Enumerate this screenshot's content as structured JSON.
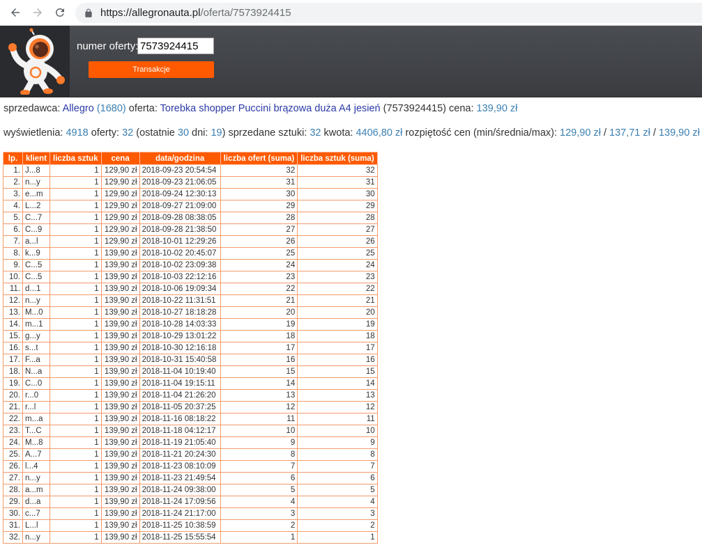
{
  "browser": {
    "url_host": "https://allegronauta.pl",
    "url_path": "/oferta/7573924415"
  },
  "header": {
    "offer_label": "numer oferty:",
    "offer_value": "7573924415",
    "button_label": "Transakcje"
  },
  "info": {
    "seller_label": "sprzedawca:",
    "seller_name": "Allegro",
    "seller_score": "(1680)",
    "offer_label": "oferta:",
    "offer_title": "Torebka shopper Puccini brązowa duża A4 jesień",
    "offer_id": "(7573924415)",
    "price_label": "cena:",
    "price": "139,90 zł",
    "views_label": "wyświetlenia:",
    "views": "4918",
    "offers_label": "oferty:",
    "offers": "32",
    "last_open": "(ostatnie",
    "last_days": "30",
    "days_label": "dni:",
    "last_count": "19",
    "last_close": ")",
    "sold_label": "sprzedane sztuki:",
    "sold": "32",
    "amount_label": "kwota:",
    "amount": "4406,80 zł",
    "range_label": "rozpiętość cen (min/średnia/max):",
    "min": "129,90 zł",
    "avg": "137,71 zł",
    "max": "139,90 zł",
    "sep": "/"
  },
  "table": {
    "headers": [
      "lp.",
      "klient",
      "liczba sztuk",
      "cena",
      "data/godzina",
      "liczba ofert (suma)",
      "liczba sztuk (suma)"
    ],
    "rows": [
      [
        "1.",
        "J...8",
        "1",
        "129,90 zł",
        "2018-09-23 20:54:54",
        "32",
        "32"
      ],
      [
        "2.",
        "n...y",
        "1",
        "129,90 zł",
        "2018-09-23 21:06:05",
        "31",
        "31"
      ],
      [
        "3.",
        "e...m",
        "1",
        "129,90 zł",
        "2018-09-24 12:30:13",
        "30",
        "30"
      ],
      [
        "4.",
        "L...2",
        "1",
        "129,90 zł",
        "2018-09-27 21:09:00",
        "29",
        "29"
      ],
      [
        "5.",
        "C...7",
        "1",
        "129,90 zł",
        "2018-09-28 08:38:05",
        "28",
        "28"
      ],
      [
        "6.",
        "C...9",
        "1",
        "129,90 zł",
        "2018-09-28 21:38:50",
        "27",
        "27"
      ],
      [
        "7.",
        "a...l",
        "1",
        "129,90 zł",
        "2018-10-01 12:29:26",
        "26",
        "26"
      ],
      [
        "8.",
        "k...9",
        "1",
        "139,90 zł",
        "2018-10-02 20:45:07",
        "25",
        "25"
      ],
      [
        "9.",
        "C...5",
        "1",
        "139,90 zł",
        "2018-10-02 23:09:38",
        "24",
        "24"
      ],
      [
        "10.",
        "C...5",
        "1",
        "139,90 zł",
        "2018-10-03 22:12:16",
        "23",
        "23"
      ],
      [
        "11.",
        "d...1",
        "1",
        "139,90 zł",
        "2018-10-06 19:09:34",
        "22",
        "22"
      ],
      [
        "12.",
        "n...y",
        "1",
        "139,90 zł",
        "2018-10-22 11:31:51",
        "21",
        "21"
      ],
      [
        "13.",
        "M...0",
        "1",
        "139,90 zł",
        "2018-10-27 18:18:28",
        "20",
        "20"
      ],
      [
        "14.",
        "m...1",
        "1",
        "139,90 zł",
        "2018-10-28 14:03:33",
        "19",
        "19"
      ],
      [
        "15.",
        "g...y",
        "1",
        "139,90 zł",
        "2018-10-29 13:01:22",
        "18",
        "18"
      ],
      [
        "16.",
        "s...t",
        "1",
        "139,90 zł",
        "2018-10-30 12:16:18",
        "17",
        "17"
      ],
      [
        "17.",
        "F...a",
        "1",
        "139,90 zł",
        "2018-10-31 15:40:58",
        "16",
        "16"
      ],
      [
        "18.",
        "N...a",
        "1",
        "139,90 zł",
        "2018-11-04 10:19:40",
        "15",
        "15"
      ],
      [
        "19.",
        "C...0",
        "1",
        "139,90 zł",
        "2018-11-04 19:15:11",
        "14",
        "14"
      ],
      [
        "20.",
        "r...0",
        "1",
        "139,90 zł",
        "2018-11-04 21:26:20",
        "13",
        "13"
      ],
      [
        "21.",
        "r...l",
        "1",
        "139,90 zł",
        "2018-11-05 20:37:25",
        "12",
        "12"
      ],
      [
        "22.",
        "m...a",
        "1",
        "139,90 zł",
        "2018-11-16 08:18:22",
        "11",
        "11"
      ],
      [
        "23.",
        "T...C",
        "1",
        "139,90 zł",
        "2018-11-18 04:12:17",
        "10",
        "10"
      ],
      [
        "24.",
        "M...8",
        "1",
        "139,90 zł",
        "2018-11-19 21:05:40",
        "9",
        "9"
      ],
      [
        "25.",
        "A...7",
        "1",
        "139,90 zł",
        "2018-11-21 20:24:30",
        "8",
        "8"
      ],
      [
        "26.",
        "l...4",
        "1",
        "139,90 zł",
        "2018-11-23 08:10:09",
        "7",
        "7"
      ],
      [
        "27.",
        "n...y",
        "1",
        "139,90 zł",
        "2018-11-23 21:49:54",
        "6",
        "6"
      ],
      [
        "28.",
        "a...m",
        "1",
        "139,90 zł",
        "2018-11-24 09:38:00",
        "5",
        "5"
      ],
      [
        "29.",
        "d...a",
        "1",
        "139,90 zł",
        "2018-11-24 17:09:56",
        "4",
        "4"
      ],
      [
        "30.",
        "c...7",
        "1",
        "139,90 zł",
        "2018-11-24 21:17:00",
        "3",
        "3"
      ],
      [
        "31.",
        "L...l",
        "1",
        "139,90 zł",
        "2018-11-25 10:38:59",
        "2",
        "2"
      ],
      [
        "32.",
        "n...y",
        "1",
        "139,90 zł",
        "2018-11-25 15:55:54",
        "1",
        "1"
      ]
    ]
  },
  "icons": {
    "back": "arrow-left-icon",
    "forward": "arrow-right-icon",
    "reload": "reload-icon",
    "lock": "lock-icon",
    "logo": "astronaut-logo"
  },
  "colors": {
    "accent": "#ff5a00",
    "header_bg": "#424549",
    "link": "#2b3aa6",
    "number": "#3c7fb1"
  }
}
